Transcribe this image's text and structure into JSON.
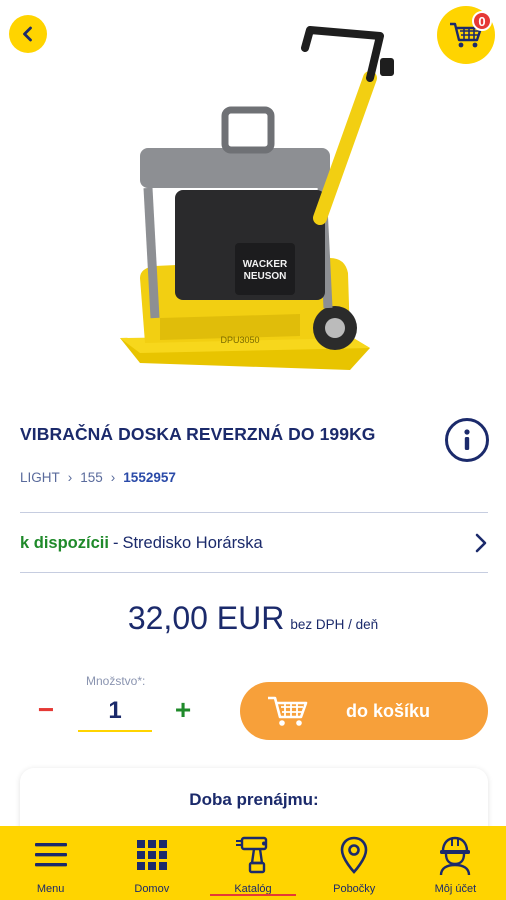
{
  "header": {
    "cart_count": "0"
  },
  "product": {
    "title": "VIBRAČNÁ DOSKA REVERZNÁ DO 199KG",
    "breadcrumb": [
      "LIGHT",
      "155",
      "1552957"
    ],
    "image_brand_text": [
      "WACKER",
      "NEUSON"
    ],
    "image_model_text": "DPU3050"
  },
  "availability": {
    "status": "k dispozícii",
    "separator": "-",
    "store": "Stredisko Horárska"
  },
  "price": {
    "amount": "32,00 EUR",
    "unit": "bez DPH / deň"
  },
  "quantity": {
    "label": "Množstvo*:",
    "value": "1",
    "minus": "−",
    "plus": "+"
  },
  "add_to_cart": {
    "label": "do košíku"
  },
  "rental": {
    "title": "Doba prenájmu:"
  },
  "bottom_nav": {
    "items": [
      {
        "label": "Menu",
        "icon": "hamburger-icon"
      },
      {
        "label": "Domov",
        "icon": "grid-icon"
      },
      {
        "label": "Katalóg",
        "icon": "drill-icon",
        "active": true
      },
      {
        "label": "Pobočky",
        "icon": "location-pin-icon"
      },
      {
        "label": "Môj účet",
        "icon": "worker-helmet-icon"
      }
    ]
  },
  "colors": {
    "brand_yellow": "#ffd400",
    "navy": "#1b2a6b",
    "cta_orange": "#f7a03a",
    "available_green": "#1f8a2a",
    "minus_red": "#e53935"
  }
}
